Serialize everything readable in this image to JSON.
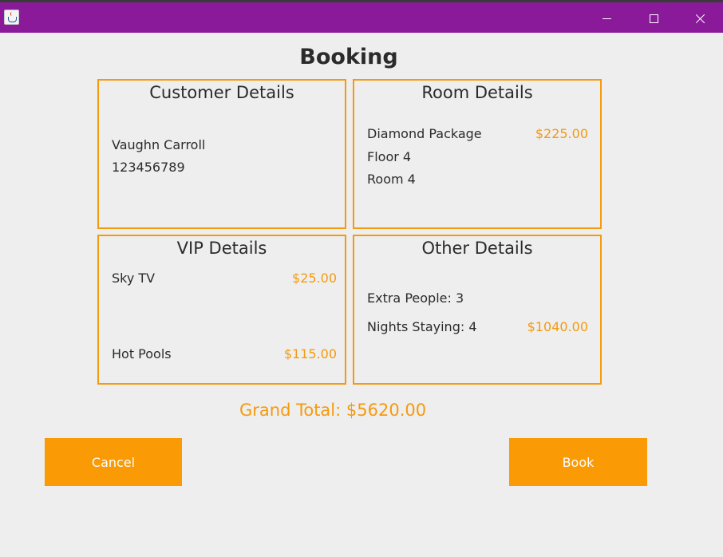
{
  "window": {
    "title": "",
    "controls": [
      "minimize",
      "maximize",
      "close"
    ]
  },
  "page": {
    "title": "Booking"
  },
  "customer": {
    "heading": "Customer Details",
    "name": "Vaughn Carroll",
    "phone": "123456789"
  },
  "room": {
    "heading": "Room Details",
    "package": "Diamond Package",
    "package_price": "$225.00",
    "floor": "Floor 4",
    "room": "Room 4"
  },
  "vip": {
    "heading": "VIP Details",
    "items": [
      {
        "label": "Sky TV",
        "price": "$25.00"
      },
      {
        "label": "Hot Pools",
        "price": "$115.00"
      }
    ]
  },
  "other": {
    "heading": "Other Details",
    "extra_people": "Extra People: 3",
    "nights": "Nights Staying: 4",
    "nights_price": "$1040.00"
  },
  "summary": {
    "grand_total": "Grand Total: $5620.00"
  },
  "actions": {
    "cancel_label": "Cancel",
    "book_label": "Book"
  },
  "colors": {
    "titlebar": "#8b1a9b",
    "accent": "#f59a0e",
    "background": "#eeeeee"
  }
}
